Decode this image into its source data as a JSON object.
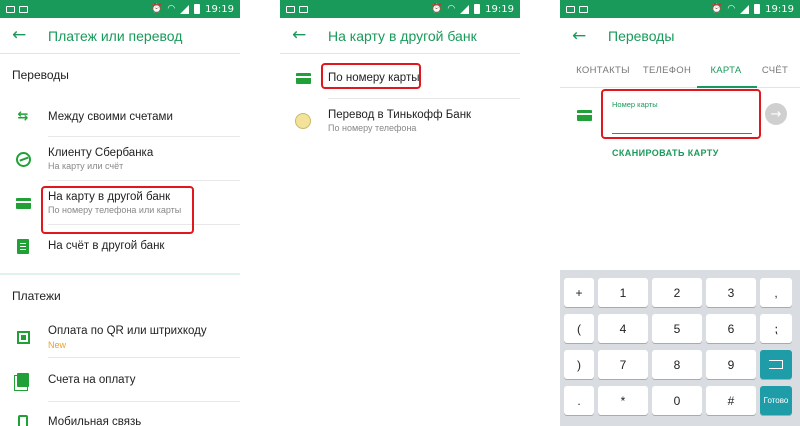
{
  "status_bar": {
    "time": "19:19",
    "battery": "91%"
  },
  "screen1": {
    "title": "Платеж или перевод",
    "sections": [
      {
        "header": "Переводы",
        "items": [
          {
            "icon": "transfer-arrows-icon",
            "label": "Между своими счетами"
          },
          {
            "icon": "sberbank-logo-icon",
            "label": "Клиенту Сбербанка",
            "sub": "На карту или счёт"
          },
          {
            "icon": "card-icon",
            "label": "На карту в другой банк",
            "sub": "По номеру телефона или карты"
          },
          {
            "icon": "document-icon",
            "label": "На счёт в другой банк"
          }
        ]
      },
      {
        "header": "Платежи",
        "items": [
          {
            "icon": "qr-code-icon",
            "label": "Оплата по QR или штрихкоду",
            "badge": "New"
          },
          {
            "icon": "bills-icon",
            "label": "Счета на оплату"
          },
          {
            "icon": "mobile-phone-icon",
            "label": "Мобильная связь"
          }
        ]
      }
    ]
  },
  "screen2": {
    "title": "На карту в другой банк",
    "items": [
      {
        "icon": "card-icon",
        "label": "По номеру карты"
      },
      {
        "icon": "tinkoff-logo-icon",
        "label": "Перевод в Тинькофф Банк",
        "sub": "По номеру телефона"
      }
    ]
  },
  "screen3": {
    "title": "Переводы",
    "tabs": [
      "КОНТАКТЫ",
      "ТЕЛЕФОН",
      "КАРТА",
      "СЧЁТ"
    ],
    "active_tab": "КАРТА",
    "card_field_label": "Номер карты",
    "card_field_value": "",
    "scan_label": "СКАНИРОВАТЬ КАРТУ",
    "keyboard": {
      "rows": [
        {
          "sym": "+",
          "nums": [
            "1",
            "2",
            "3"
          ],
          "tail": ","
        },
        {
          "sym": "(",
          "nums": [
            "4",
            "5",
            "6"
          ],
          "tail": "⁏"
        },
        {
          "sym": ")",
          "nums": [
            "7",
            "8",
            "9"
          ],
          "tail": "backspace"
        },
        {
          "sym": ".",
          "nums": [
            "*",
            "0",
            "#"
          ],
          "tail": "Готово"
        }
      ]
    }
  },
  "colors": {
    "brand_green": "#1a9a5a",
    "highlight_red": "#e0181e",
    "keyboard_action": "#1e9ca8"
  }
}
